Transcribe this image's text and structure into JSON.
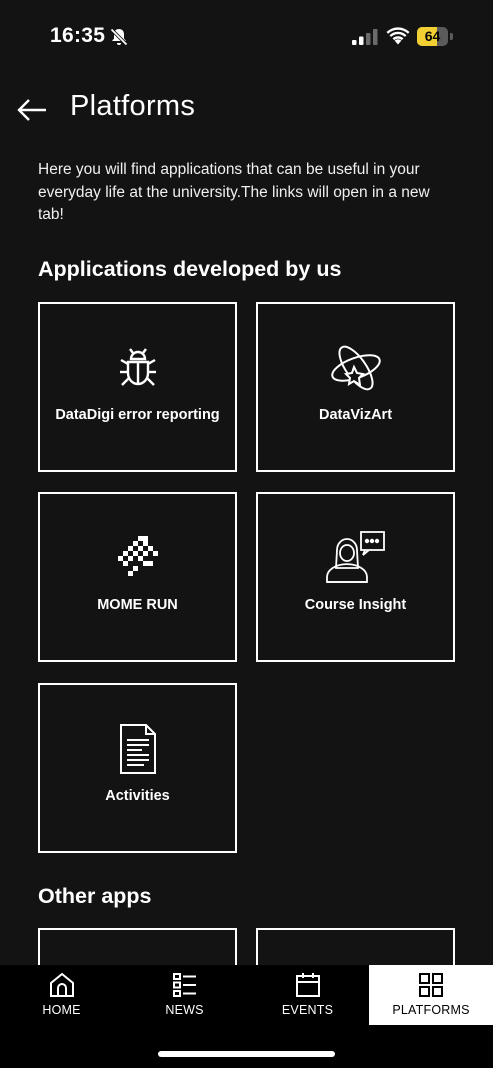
{
  "status_bar": {
    "time": "16:35",
    "battery": "64",
    "battery_level": 0.64,
    "icons": [
      "bell-muted-icon",
      "signal-icon",
      "wifi-icon",
      "battery-icon"
    ]
  },
  "header": {
    "title": "Platforms",
    "back_icon": "arrow-left-icon"
  },
  "intro": "Here you will find applications that can be useful in your everyday life at the university.The links will open in a new tab!",
  "sections": [
    {
      "title": "Applications developed by us",
      "apps": [
        {
          "label": "DataDigi error reporting",
          "icon": "bug-icon"
        },
        {
          "label": "DataVizArt",
          "icon": "atom-star-icon"
        },
        {
          "label": "MOME RUN",
          "icon": "pixel-runner-icon"
        },
        {
          "label": "Course Insight",
          "icon": "person-speech-icon"
        },
        {
          "label": "Activities",
          "icon": "document-icon"
        }
      ]
    },
    {
      "title": "Other apps"
    }
  ],
  "bottom_nav": [
    {
      "label": "HOME",
      "icon": "home-icon"
    },
    {
      "label": "NEWS",
      "icon": "list-icon"
    },
    {
      "label": "EVENTS",
      "icon": "calendar-icon"
    },
    {
      "label": "PLATFORMS",
      "icon": "grid-icon",
      "active": true
    }
  ],
  "colors": {
    "background": "#131313",
    "text": "#ffffff",
    "battery": "#f2d033",
    "active_nav_bg": "#ffffff"
  }
}
